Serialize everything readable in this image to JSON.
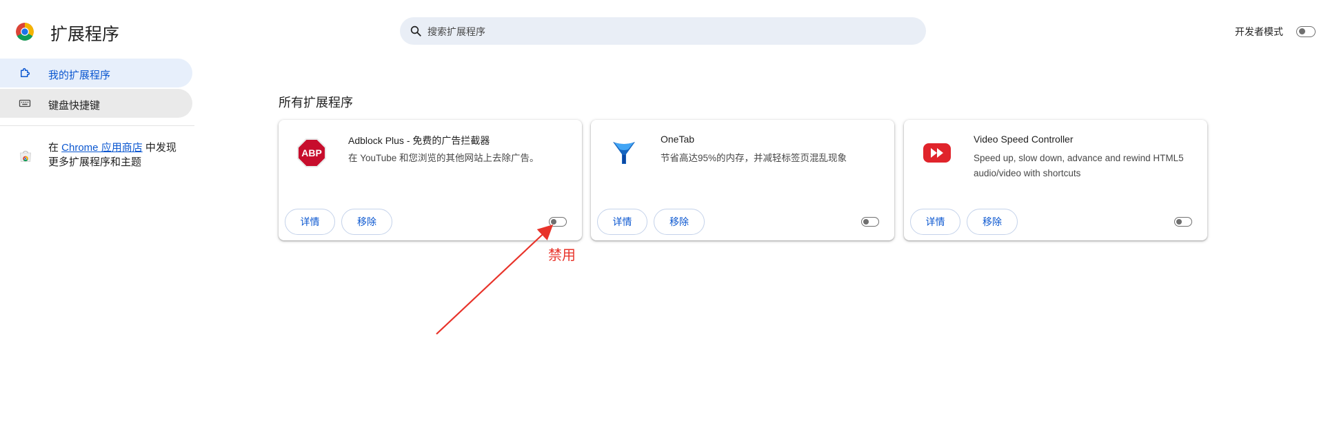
{
  "header": {
    "title": "扩展程序",
    "search_placeholder": "搜索扩展程序",
    "developer_mode_label": "开发者模式",
    "developer_mode_on": false
  },
  "sidebar": {
    "items": [
      {
        "label": "我的扩展程序",
        "icon": "puzzle-icon",
        "active": true
      },
      {
        "label": "键盘快捷键",
        "icon": "keyboard-icon",
        "active": false
      }
    ],
    "store_promo": {
      "prefix": "在 ",
      "link_text": "Chrome 应用商店",
      "suffix": " 中发现更多扩展程序和主题",
      "icon": "chrome-webstore-icon"
    }
  },
  "main": {
    "section_title": "所有扩展程序",
    "extensions": [
      {
        "name": "Adblock Plus - 免费的广告拦截器",
        "description": "在 YouTube 和您浏览的其他网站上去除广告。",
        "icon": "abp-icon",
        "enabled": false,
        "details_label": "详情",
        "remove_label": "移除"
      },
      {
        "name": "OneTab",
        "description": "节省高达95%的内存，并减轻标签页混乱现象",
        "icon": "onetab-funnel-icon",
        "enabled": false,
        "details_label": "详情",
        "remove_label": "移除"
      },
      {
        "name": "Video Speed Controller",
        "description": "Speed up, slow down, advance and rewind HTML5 audio/video with shortcuts",
        "icon": "fast-forward-icon",
        "enabled": false,
        "details_label": "详情",
        "remove_label": "移除"
      }
    ]
  },
  "annotation": {
    "label": "禁用",
    "color": "#e8332a"
  },
  "colors": {
    "accent": "#0b57d0",
    "sidebar_active_bg": "#e7effb",
    "search_bg": "#e9eef6"
  }
}
